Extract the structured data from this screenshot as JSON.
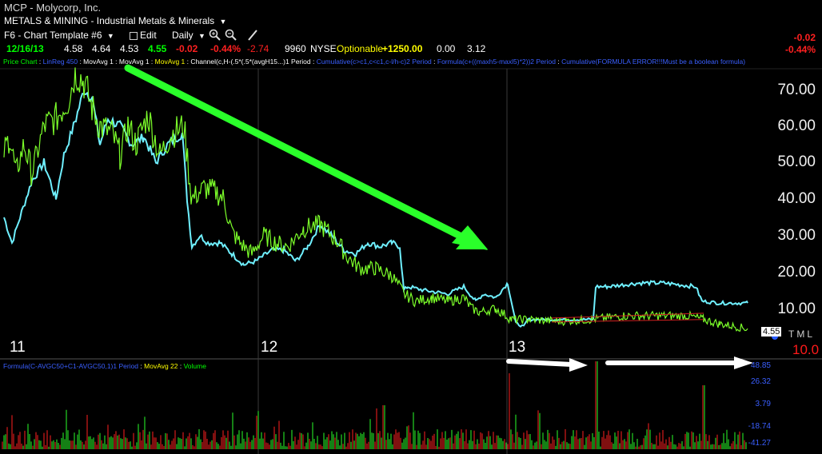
{
  "header": {
    "title": "MCP - Molycorp, Inc.",
    "sector": "METALS & MINING - Industrial Metals & Minerals",
    "sector_arrow": "▼"
  },
  "toolbar": {
    "template": "F6 - Chart Template #6",
    "template_arrow": "▼",
    "edit": "Edit",
    "period": "Daily",
    "period_arrow": "▼"
  },
  "quote": {
    "date": "12/16/13",
    "open": "4.58",
    "high": "4.64",
    "low": "4.53",
    "last": "4.55",
    "change": "-0.02",
    "change_pct": "-0.44%",
    "arrow_val": "-2.74",
    "volume": "9960",
    "exchange": "NYSE",
    "optionable": "Optionable",
    "option_val": "+1250.00",
    "v1": "0.00",
    "v2": "3.12"
  },
  "right_change": {
    "change": "-0.02",
    "change_pct": "-0.44%"
  },
  "studies": [
    {
      "text": "Price Chart",
      "color": "#00ff00"
    },
    {
      "text": " : ",
      "color": "#ffffff"
    },
    {
      "text": "LinReg 450",
      "color": "#3a5fff"
    },
    {
      "text": " : MovAvg 1 : MovAvg 1 : ",
      "color": "#ffffff"
    },
    {
      "text": "MovAvg 1",
      "color": "#ffff00"
    },
    {
      "text": " : Channel(c,H-(.5*(.5*(avgH15...)1 Period : ",
      "color": "#ffffff"
    },
    {
      "text": "Cumulative(c>c1,c<c1,c-l/h-c)2 Period",
      "color": "#3a5fff"
    },
    {
      "text": " : ",
      "color": "#ffffff"
    },
    {
      "text": "Formula(c+((maxh5-maxl5)*2))2 Period",
      "color": "#3a5fff"
    },
    {
      "text": " : ",
      "color": "#ffffff"
    },
    {
      "text": "Cumulative(FORMULA ERROR!!!Must be a boolean formula)",
      "color": "#3a5fff"
    }
  ],
  "lower_legend": [
    {
      "text": "Formula(C-AVGC50+C1-AVGC50,1)1 Period",
      "color": "#3a5fff"
    },
    {
      "text": " : ",
      "color": "#ffffff"
    },
    {
      "text": "MovAvg 22",
      "color": "#ffff00"
    },
    {
      "text": " : ",
      "color": "#ffffff"
    },
    {
      "text": "Volume",
      "color": "#00ff00"
    }
  ],
  "y_axis_price": [
    "70.00",
    "60.00",
    "50.00",
    "40.00",
    "30.00",
    "20.00",
    "10.00"
  ],
  "y_axis_volume": [
    "48.85",
    "26.32",
    "3.79",
    "-18.74",
    "-41.27"
  ],
  "x_axis": [
    "11",
    "12",
    "13"
  ],
  "last_price_chip": "4.55",
  "tml": "TML",
  "last_big": "10.0",
  "colors": {
    "background": "#000000",
    "price_green": "#7cff2a",
    "cyan_line": "#6ff0ff",
    "red": "#ff1a1a",
    "blue_text": "#3a5fff",
    "down_arrow": "#2aff2a",
    "white_arrows": "#ffffff"
  },
  "icons": [
    "zoom-in-icon",
    "zoom-out-icon",
    "pen-icon"
  ]
}
